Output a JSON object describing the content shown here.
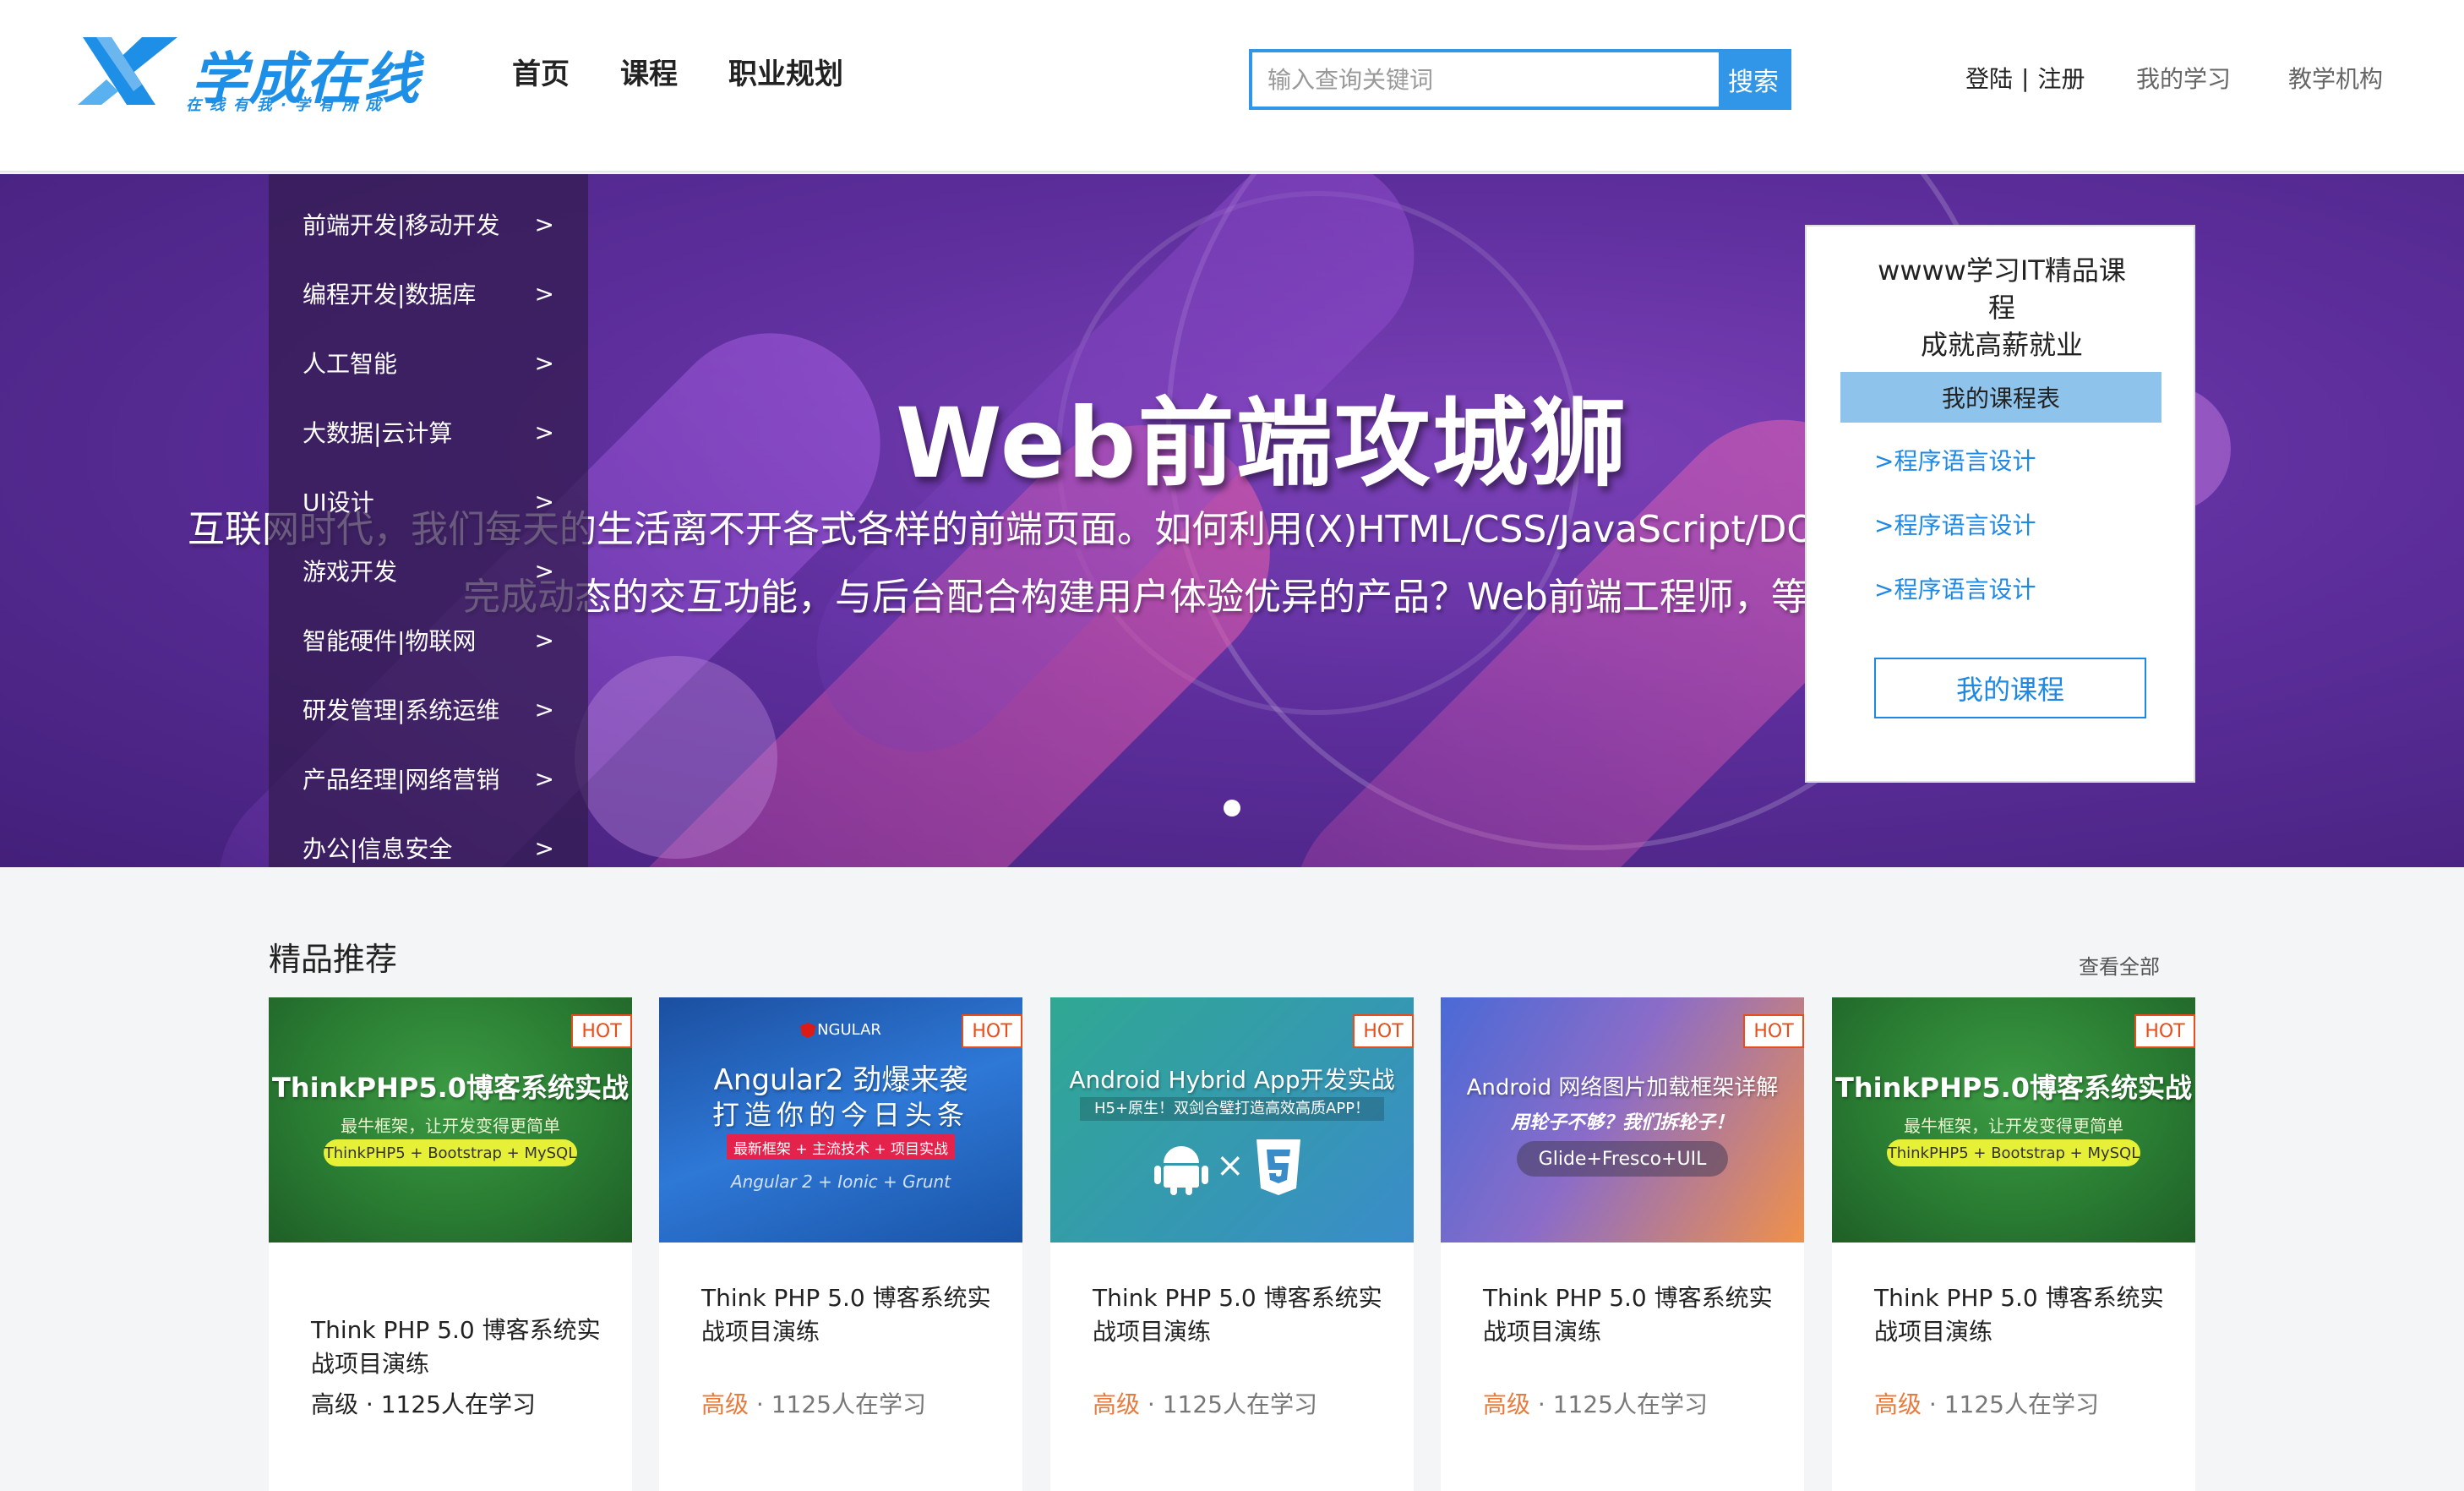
{
  "header": {
    "logo_text": "学成在线",
    "logo_sub": "在线有我·学有所成",
    "nav": [
      "首页",
      "课程",
      "职业规划"
    ],
    "search_placeholder": "输入查询关键词",
    "search_button": "搜索",
    "login": "登陆",
    "register": "注册",
    "my_learning": "我的学习",
    "institution": "教学机构"
  },
  "banner": {
    "title": "Web前端攻城狮",
    "line1": "互联网时代，我们每天的生活离不开各式各样的前端页面。如何利用(X)HTML/CSS/JavaScript/DOM构建前端页面，",
    "line2": "完成动态的交互功能，与后台配合构建用户体验优异的产品？Web前端工程师，等",
    "categories": [
      "前端开发|移动开发",
      "编程开发|数据库",
      "人工智能",
      "大数据|云计算",
      "UI设计",
      "游戏开发",
      "智能硬件|物联网",
      "研发管理|系统运维",
      "产品经理|网络营销",
      "办公|信息安全"
    ],
    "arrow": ">"
  },
  "side_card": {
    "title_lines": [
      "wwww学习IT精品课",
      "程",
      "成就高薪就业"
    ],
    "tab": "我的课程表",
    "links": [
      ">程序语言设计",
      ">程序语言设计",
      ">程序语言设计"
    ],
    "button": "我的课程"
  },
  "recommend": {
    "title": "精品推荐",
    "view_all": "查看全部",
    "hot_label": "HOT",
    "courses": [
      {
        "name": "Think PHP 5.0 博客系统实战项目演练",
        "level": "高级",
        "students": "1125人在学习",
        "thumb_title": "ThinkPHP5.0博客系统实战",
        "thumb_sub": "最牛框架，让开发变得更简单",
        "thumb_pill": "ThinkPHP5 + Bootstrap + MySQL"
      },
      {
        "name": "Think PHP 5.0 博客系统实战项目演练",
        "level": "高级",
        "students": "1125人在学习",
        "thumb_brand": "NGULAR",
        "thumb_title": "Angular2 劲爆来袭",
        "thumb_title2": "打造你的今日头条",
        "thumb_pill": "最新框架 + 主流技术 + 项目实战",
        "thumb_sub": "Angular 2 + Ionic + Grunt"
      },
      {
        "name": "Think PHP 5.0 博客系统实战项目演练",
        "level": "高级",
        "students": "1125人在学习",
        "thumb_title": "Android Hybrid App开发实战",
        "thumb_sub": "H5+原生！双剑合璧打造高效高质APP！"
      },
      {
        "name": "Think PHP 5.0 博客系统实战项目演练",
        "level": "高级",
        "students": "1125人在学习",
        "thumb_title": "Android 网络图片加载框架详解",
        "thumb_sub": "用轮子不够？我们拆轮子！",
        "thumb_pill": "Glide+Fresco+UIL"
      },
      {
        "name": "Think PHP 5.0 博客系统实战项目演练",
        "level": "高级",
        "students": "1125人在学习",
        "thumb_title": "ThinkPHP5.0博客系统实战",
        "thumb_sub": "最牛框架，让开发变得更简单",
        "thumb_pill": "ThinkPHP5 + Bootstrap + MySQL"
      }
    ],
    "meta_sep": " · "
  },
  "colors": {
    "brand_blue": "#3196e7",
    "hot_orange": "#e84e1b",
    "level_orange": "#e87b3c"
  }
}
